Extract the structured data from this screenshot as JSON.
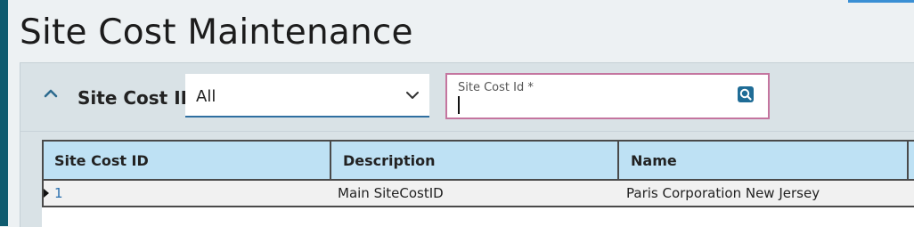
{
  "page": {
    "title": "Site Cost Maintenance"
  },
  "filter": {
    "section_label": "Site Cost ID",
    "selected_option": "All",
    "search_field_label": "Site Cost Id *",
    "search_value": ""
  },
  "colors": {
    "rail": "#0f5b6f",
    "header_bg": "#bee1f4",
    "link": "#2a6fae",
    "field_border": "#c4759f"
  },
  "icons": {
    "collapse": "chevron-up-icon",
    "dropdown": "chevron-down-icon",
    "lookup": "search-icon"
  },
  "grid": {
    "columns": [
      "Site Cost ID",
      "Description",
      "Name"
    ],
    "rows": [
      {
        "id": "1",
        "description": "Main SiteCostID",
        "name": "Paris Corporation New Jersey"
      }
    ]
  }
}
